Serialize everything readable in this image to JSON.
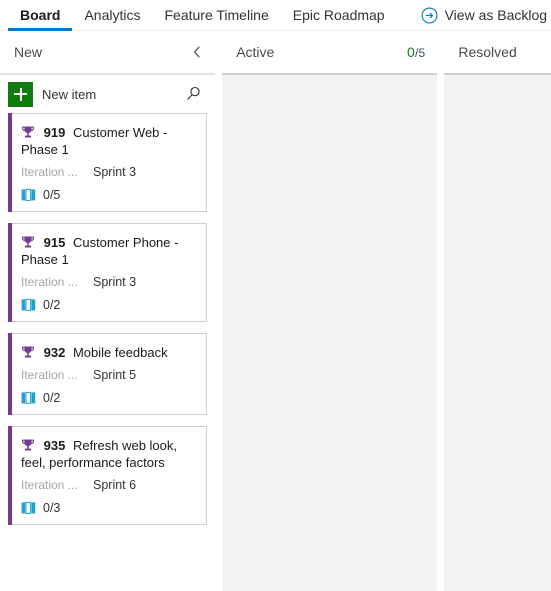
{
  "nav": {
    "tabs": [
      {
        "label": "Board",
        "active": true
      },
      {
        "label": "Analytics",
        "active": false
      },
      {
        "label": "Feature Timeline",
        "active": false
      },
      {
        "label": "Epic Roadmap",
        "active": false
      }
    ],
    "view_as_backlog": {
      "label": "View as Backlog",
      "icon": "circle-arrow-right-icon"
    },
    "active_tab_color": "#0078d4"
  },
  "toolbar": {
    "new_item_label": "New item",
    "new_item_icon": "plus-icon",
    "search_icon": "search-icon",
    "new_item_button_color": "#107c10"
  },
  "columns": [
    {
      "title": "New",
      "collapse_icon": "chevron-left-icon",
      "wip": null
    },
    {
      "title": "Active",
      "collapse_icon": null,
      "wip": {
        "current": "0",
        "separator": "/",
        "limit": "5",
        "current_color": "#107c10"
      }
    },
    {
      "title": "Resolved",
      "collapse_icon": null,
      "wip": null
    }
  ],
  "cards": [
    {
      "type_icon": "trophy-icon",
      "id": "919",
      "title": "Customer Web - Phase 1",
      "field_label": "Iteration ...",
      "field_value": "Sprint 3",
      "rollup_icon": "child-items-icon",
      "rollup_text": "0/5",
      "accent_color": "#773b93"
    },
    {
      "type_icon": "trophy-icon",
      "id": "915",
      "title": "Customer Phone - Phase 1",
      "field_label": "Iteration ...",
      "field_value": "Sprint 3",
      "rollup_icon": "child-items-icon",
      "rollup_text": "0/2",
      "accent_color": "#773b93"
    },
    {
      "type_icon": "trophy-icon",
      "id": "932",
      "title": "Mobile feedback",
      "field_label": "Iteration ...",
      "field_value": "Sprint 5",
      "rollup_icon": "child-items-icon",
      "rollup_text": "0/2",
      "accent_color": "#773b93"
    },
    {
      "type_icon": "trophy-icon",
      "id": "935",
      "title": "Refresh web look, feel, performance factors",
      "field_label": "Iteration ...",
      "field_value": "Sprint 6",
      "rollup_icon": "child-items-icon",
      "rollup_text": "0/3",
      "accent_color": "#773b93"
    }
  ]
}
